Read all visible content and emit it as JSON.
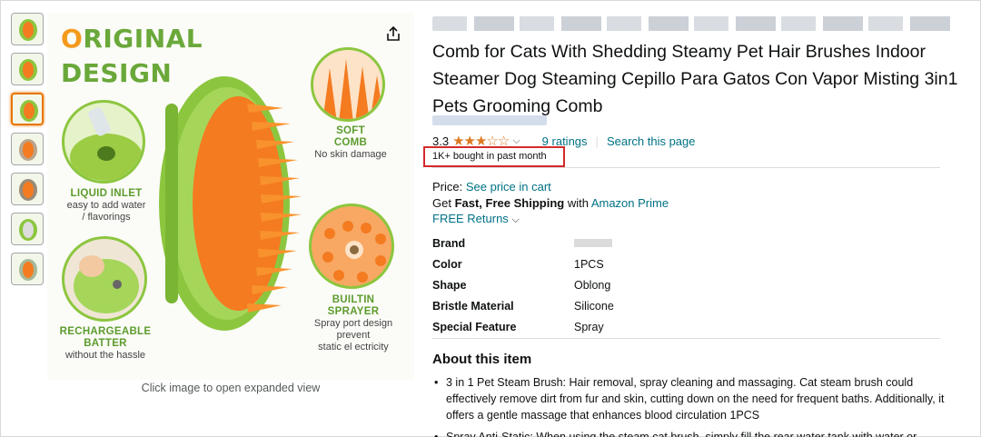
{
  "gallery": {
    "thumbnails": [
      "thumb-1",
      "thumb-2",
      "thumb-3",
      "thumb-4",
      "thumb-5",
      "thumb-6",
      "thumb-7"
    ],
    "active_index": 2,
    "caption": "Click image to open expanded view",
    "image": {
      "headline_first": "O",
      "headline_rest": "RIGINAL",
      "headline_line2": "DESIGN",
      "callouts": {
        "soft_comb_title": "SOFT\nCOMB",
        "soft_comb_desc": "No skin damage",
        "liquid_inlet_title": "LIQUID INLET",
        "liquid_inlet_desc": "easy to add water\n/ flavorings",
        "rechargeable_title": "RECHARGEABLE\nBATTER",
        "rechargeable_desc": "without the hassle",
        "sprayer_title": "BUILTIN\nSPRAYER",
        "sprayer_desc": "Spray port design\nprevent\nstatic el ectricity"
      }
    }
  },
  "product": {
    "title": "Comb for Cats With Shedding Steamy Pet Hair Brushes Indoor Steamer Dog Steaming Cepillo Para Gatos Con Vapor Misting 3in1 Pets Grooming Comb",
    "rating_value": "3.3",
    "stars": "★★★☆☆",
    "ratings_link": "9 ratings",
    "search_link": "Search this page",
    "bought": "1K+ bought in past month",
    "price_label": "Price:",
    "price_link": "See price in cart",
    "shipping_prefix": "Get ",
    "shipping_bold": "Fast, Free Shipping",
    "shipping_mid": " with ",
    "shipping_link": "Amazon Prime",
    "returns_link": "FREE Returns",
    "specs": [
      {
        "key": "Brand",
        "value": ""
      },
      {
        "key": "Color",
        "value": "1PCS"
      },
      {
        "key": "Shape",
        "value": "Oblong"
      },
      {
        "key": "Bristle Material",
        "value": "Silicone"
      },
      {
        "key": "Special Feature",
        "value": "Spray"
      }
    ],
    "about_title": "About this item",
    "bullets": [
      "3 in 1 Pet Steam Brush: Hair removal, spray cleaning and massaging. Cat steam brush could effectively remove dirt from fur and skin, cutting down on the need for frequent baths. Additionally, it offers a gentle massage that enhances blood circulation 1PCS",
      "Spray Anti-Static: When using the steam cat brush, simply fill the rear water tank with water or"
    ]
  },
  "colors": {
    "link": "#007185",
    "star": "#de7921",
    "highlight_box": "#d42a2a",
    "brand_green": "#8cc63f",
    "brand_orange": "#f47b20"
  }
}
